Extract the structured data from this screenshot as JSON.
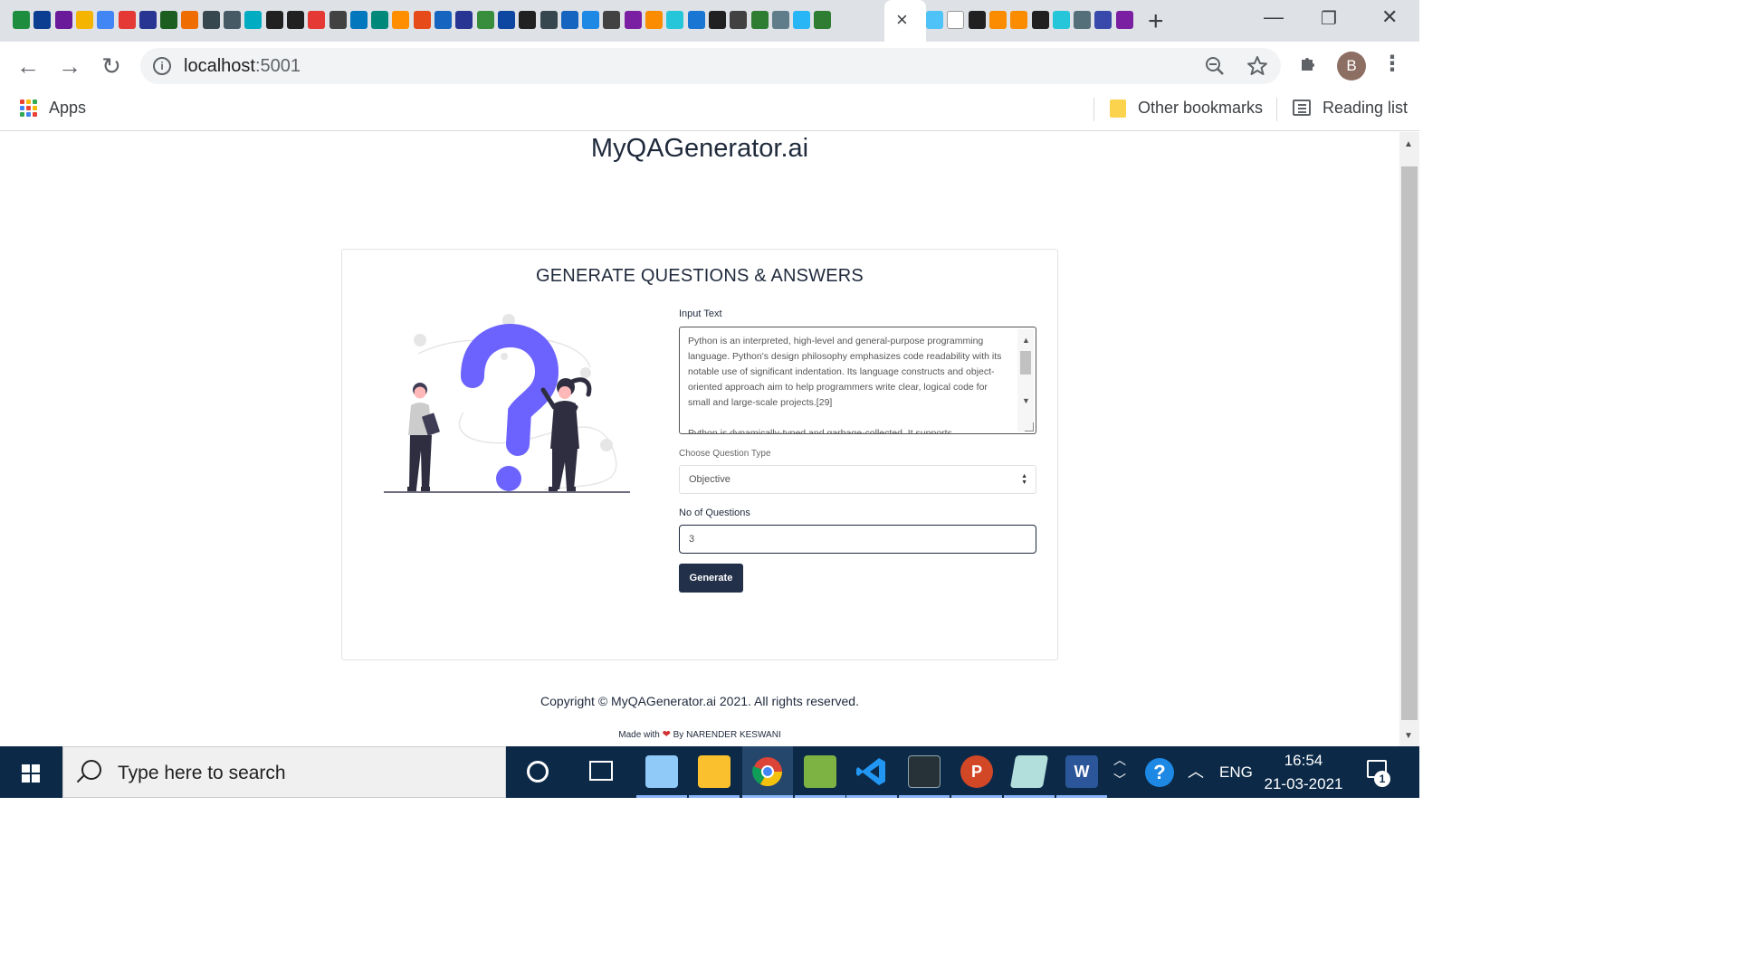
{
  "browser": {
    "tab_favicon_colors": [
      "#1e8e3e",
      "#0b3d91",
      "#6a1b9a",
      "#f4b400",
      "#4285f4",
      "#e53935",
      "#283593",
      "#1b5e20",
      "#ef6c00",
      "#37474f",
      "#455a64",
      "#00acc1",
      "#212121",
      "#212121",
      "#e53935",
      "#424242",
      "#0277bd",
      "#00897b",
      "#ff8f00",
      "#e64a19",
      "#1565c0",
      "#283593",
      "#388e3c",
      "#0d47a1",
      "#212121",
      "#37474f",
      "#1565c0",
      "#1e88e5",
      "#424242",
      "#7b1fa2",
      "#fb8c00",
      "#26c6da",
      "#1976d2",
      "#212121",
      "#424242",
      "#2e7d32",
      "#607d8b",
      "#29b6f6",
      "#2e7d32"
    ],
    "tab_favicon_colors_right": [
      "#4fc3f7",
      "#ffffff",
      "#212121",
      "#fb8c00",
      "#fb8c00",
      "#212121",
      "#26c6da",
      "#546e7a",
      "#3949ab",
      "#7b1fa2"
    ],
    "active_tab_close": "×",
    "new_tab": "+",
    "window_controls": {
      "minimize": "—",
      "restore": "❐",
      "close": "✕"
    },
    "nav": {
      "back": "←",
      "forward": "→",
      "reload": "↻"
    },
    "url": {
      "host": "localhost",
      "port": ":5001"
    },
    "profile_initial": "B",
    "bookmarks": {
      "apps_label": "Apps",
      "other_bookmarks": "Other bookmarks",
      "reading_list": "Reading list"
    }
  },
  "page": {
    "site_title": "MyQAGenerator.ai",
    "card_heading": "GENERATE QUESTIONS & ANSWERS",
    "form": {
      "input_text_label": "Input Text",
      "input_text_value": "Python is an interpreted, high-level and general-purpose programming language. Python's design philosophy emphasizes code readability with its notable use of significant indentation. Its language constructs and object-oriented approach aim to help programmers write clear, logical code for small and large-scale projects.[29]",
      "input_text_value_2": "Python is dynamically-typed and garbage-collected. It supports",
      "question_type_label": "Choose Question Type",
      "question_type_value": "Objective",
      "num_questions_label": "No of Questions",
      "num_questions_value": "3",
      "generate_label": "Generate"
    },
    "footer": {
      "copyright": "Copyright © MyQAGenerator.ai 2021. All rights reserved.",
      "made_with_prefix": "Made with",
      "made_with_suffix": "By NARENDER KESWANI"
    },
    "colors": {
      "brand_dark": "#23304a",
      "illustration_accent": "#6c63ff"
    }
  },
  "taskbar": {
    "search_placeholder": "Type here to search",
    "language": "ENG",
    "time": "16:54",
    "date": "21-03-2021",
    "notification_count": "1",
    "apps": [
      "snipping-tool",
      "file-explorer",
      "chrome",
      "notepad-plus-plus",
      "vscode",
      "mysql-workbench",
      "powerpoint",
      "app-generic",
      "word"
    ]
  }
}
